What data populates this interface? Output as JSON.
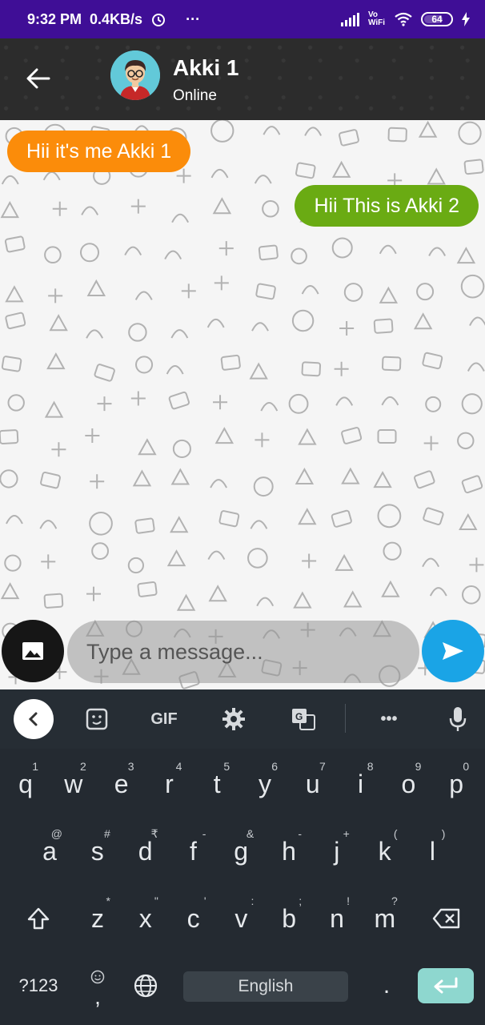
{
  "status_bar": {
    "time": "9:32 PM",
    "speed": "0.4KB/s",
    "dots": "···",
    "volte": "Vo WiFi",
    "battery": "64"
  },
  "header": {
    "contact_name": "Akki 1",
    "contact_status": "Online"
  },
  "messages": [
    {
      "direction": "incoming",
      "text": "Hii it's me Akki 1",
      "color": "#fb8c0a"
    },
    {
      "direction": "outgoing",
      "text": "Hii This is Akki 2",
      "color": "#6aab13"
    }
  ],
  "composer": {
    "placeholder": "Type a message..."
  },
  "keyboard": {
    "toolbar": {
      "gif": "GIF",
      "more": "•••"
    },
    "row1": [
      {
        "key": "q",
        "hint": "1"
      },
      {
        "key": "w",
        "hint": "2"
      },
      {
        "key": "e",
        "hint": "3"
      },
      {
        "key": "r",
        "hint": "4"
      },
      {
        "key": "t",
        "hint": "5"
      },
      {
        "key": "y",
        "hint": "6"
      },
      {
        "key": "u",
        "hint": "7"
      },
      {
        "key": "i",
        "hint": "8"
      },
      {
        "key": "o",
        "hint": "9"
      },
      {
        "key": "p",
        "hint": "0"
      }
    ],
    "row2": [
      {
        "key": "a",
        "hint": "@"
      },
      {
        "key": "s",
        "hint": "#"
      },
      {
        "key": "d",
        "hint": "₹"
      },
      {
        "key": "f",
        "hint": "-"
      },
      {
        "key": "g",
        "hint": "&"
      },
      {
        "key": "h",
        "hint": "-"
      },
      {
        "key": "j",
        "hint": "+"
      },
      {
        "key": "k",
        "hint": "("
      },
      {
        "key": "l",
        "hint": ")"
      }
    ],
    "row3": [
      {
        "key": "z",
        "hint": "*"
      },
      {
        "key": "x",
        "hint": "\""
      },
      {
        "key": "c",
        "hint": "'"
      },
      {
        "key": "v",
        "hint": ":"
      },
      {
        "key": "b",
        "hint": ";"
      },
      {
        "key": "n",
        "hint": "!"
      },
      {
        "key": "m",
        "hint": "?"
      }
    ],
    "symbols_label": "?123",
    "emoji_comma": ",",
    "space_label": "English",
    "period": "."
  },
  "colors": {
    "status_bar": "#3f0e96",
    "send_button": "#1aa4e6",
    "enter_key": "#8ed7cf"
  }
}
